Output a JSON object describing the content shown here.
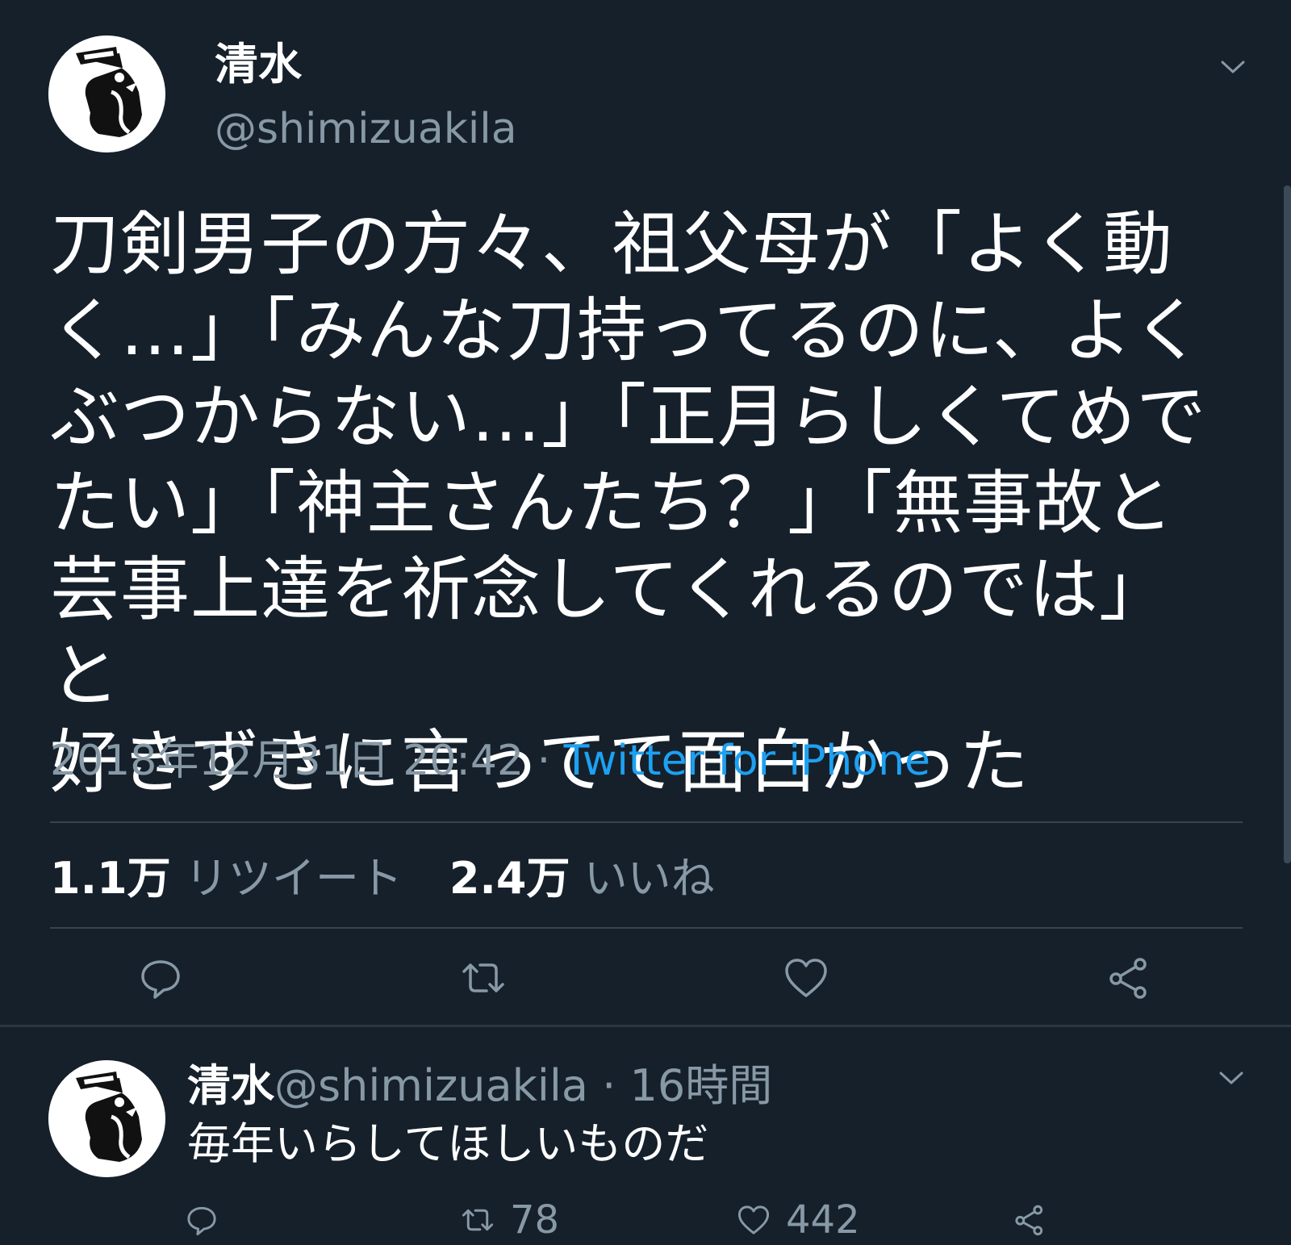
{
  "tweet": {
    "display_name": "清水",
    "handle": "@shimizuakila",
    "avatar_icon": "penguin-avatar-icon",
    "text": "刀剣男子の方々、祖父母が「よく動\nく…」「みんな刀持ってるのに、よく\nぶつからない…」「正月らしくてめで\nたい」「神主さんたち？」「無事故と\n芸事上達を祈念してくれるのでは」と\n好きずきに言ってて面白かった",
    "timestamp": "2018年12月31日 20:42",
    "separator": " · ",
    "source": "Twitter for iPhone",
    "stats": {
      "retweets_count": "1.1万",
      "retweets_label": "リツイート",
      "likes_count": "2.4万",
      "likes_label": "いいね"
    },
    "actions": [
      "reply-icon",
      "retweet-icon",
      "like-icon",
      "share-icon"
    ]
  },
  "reply": {
    "display_name": "清水",
    "handle": "@shimizuakila",
    "separator": " · ",
    "time": "16時間",
    "text": "毎年いらしてほしいものだ",
    "retweets": "78",
    "likes": "442"
  },
  "colors": {
    "background": "#15202b",
    "text": "#ffffff",
    "secondary": "#8899a6",
    "link": "#1da1f2",
    "divider": "#38444d"
  }
}
